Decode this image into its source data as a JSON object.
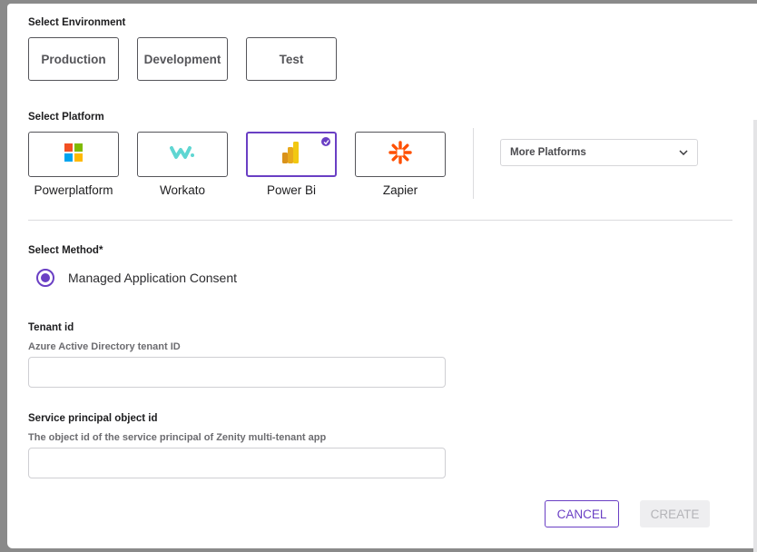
{
  "environment": {
    "label": "Select Environment",
    "options": [
      "Production",
      "Development",
      "Test"
    ]
  },
  "platform": {
    "label": "Select Platform",
    "options": [
      {
        "name": "Powerplatform",
        "icon": "microsoft-logo-icon",
        "selected": false
      },
      {
        "name": "Workato",
        "icon": "workato-logo-icon",
        "selected": false
      },
      {
        "name": "Power Bi",
        "icon": "power-bi-logo-icon",
        "selected": true
      },
      {
        "name": "Zapier",
        "icon": "zapier-logo-icon",
        "selected": false
      }
    ],
    "more_label": "More Platforms"
  },
  "method": {
    "label": "Select Method*",
    "option": "Managed Application Consent",
    "selected": true
  },
  "tenant": {
    "label": "Tenant id",
    "help": "Azure Active Directory tenant ID",
    "value": ""
  },
  "service_principal": {
    "label": "Service principal object id",
    "help": "The object id of the service principal of Zenity multi-tenant app",
    "value": ""
  },
  "actions": {
    "cancel": "CANCEL",
    "create": "CREATE"
  },
  "colors": {
    "accent": "#6a3fc4",
    "disabled_bg": "#eeeef0",
    "disabled_text": "#b4b4b8"
  }
}
